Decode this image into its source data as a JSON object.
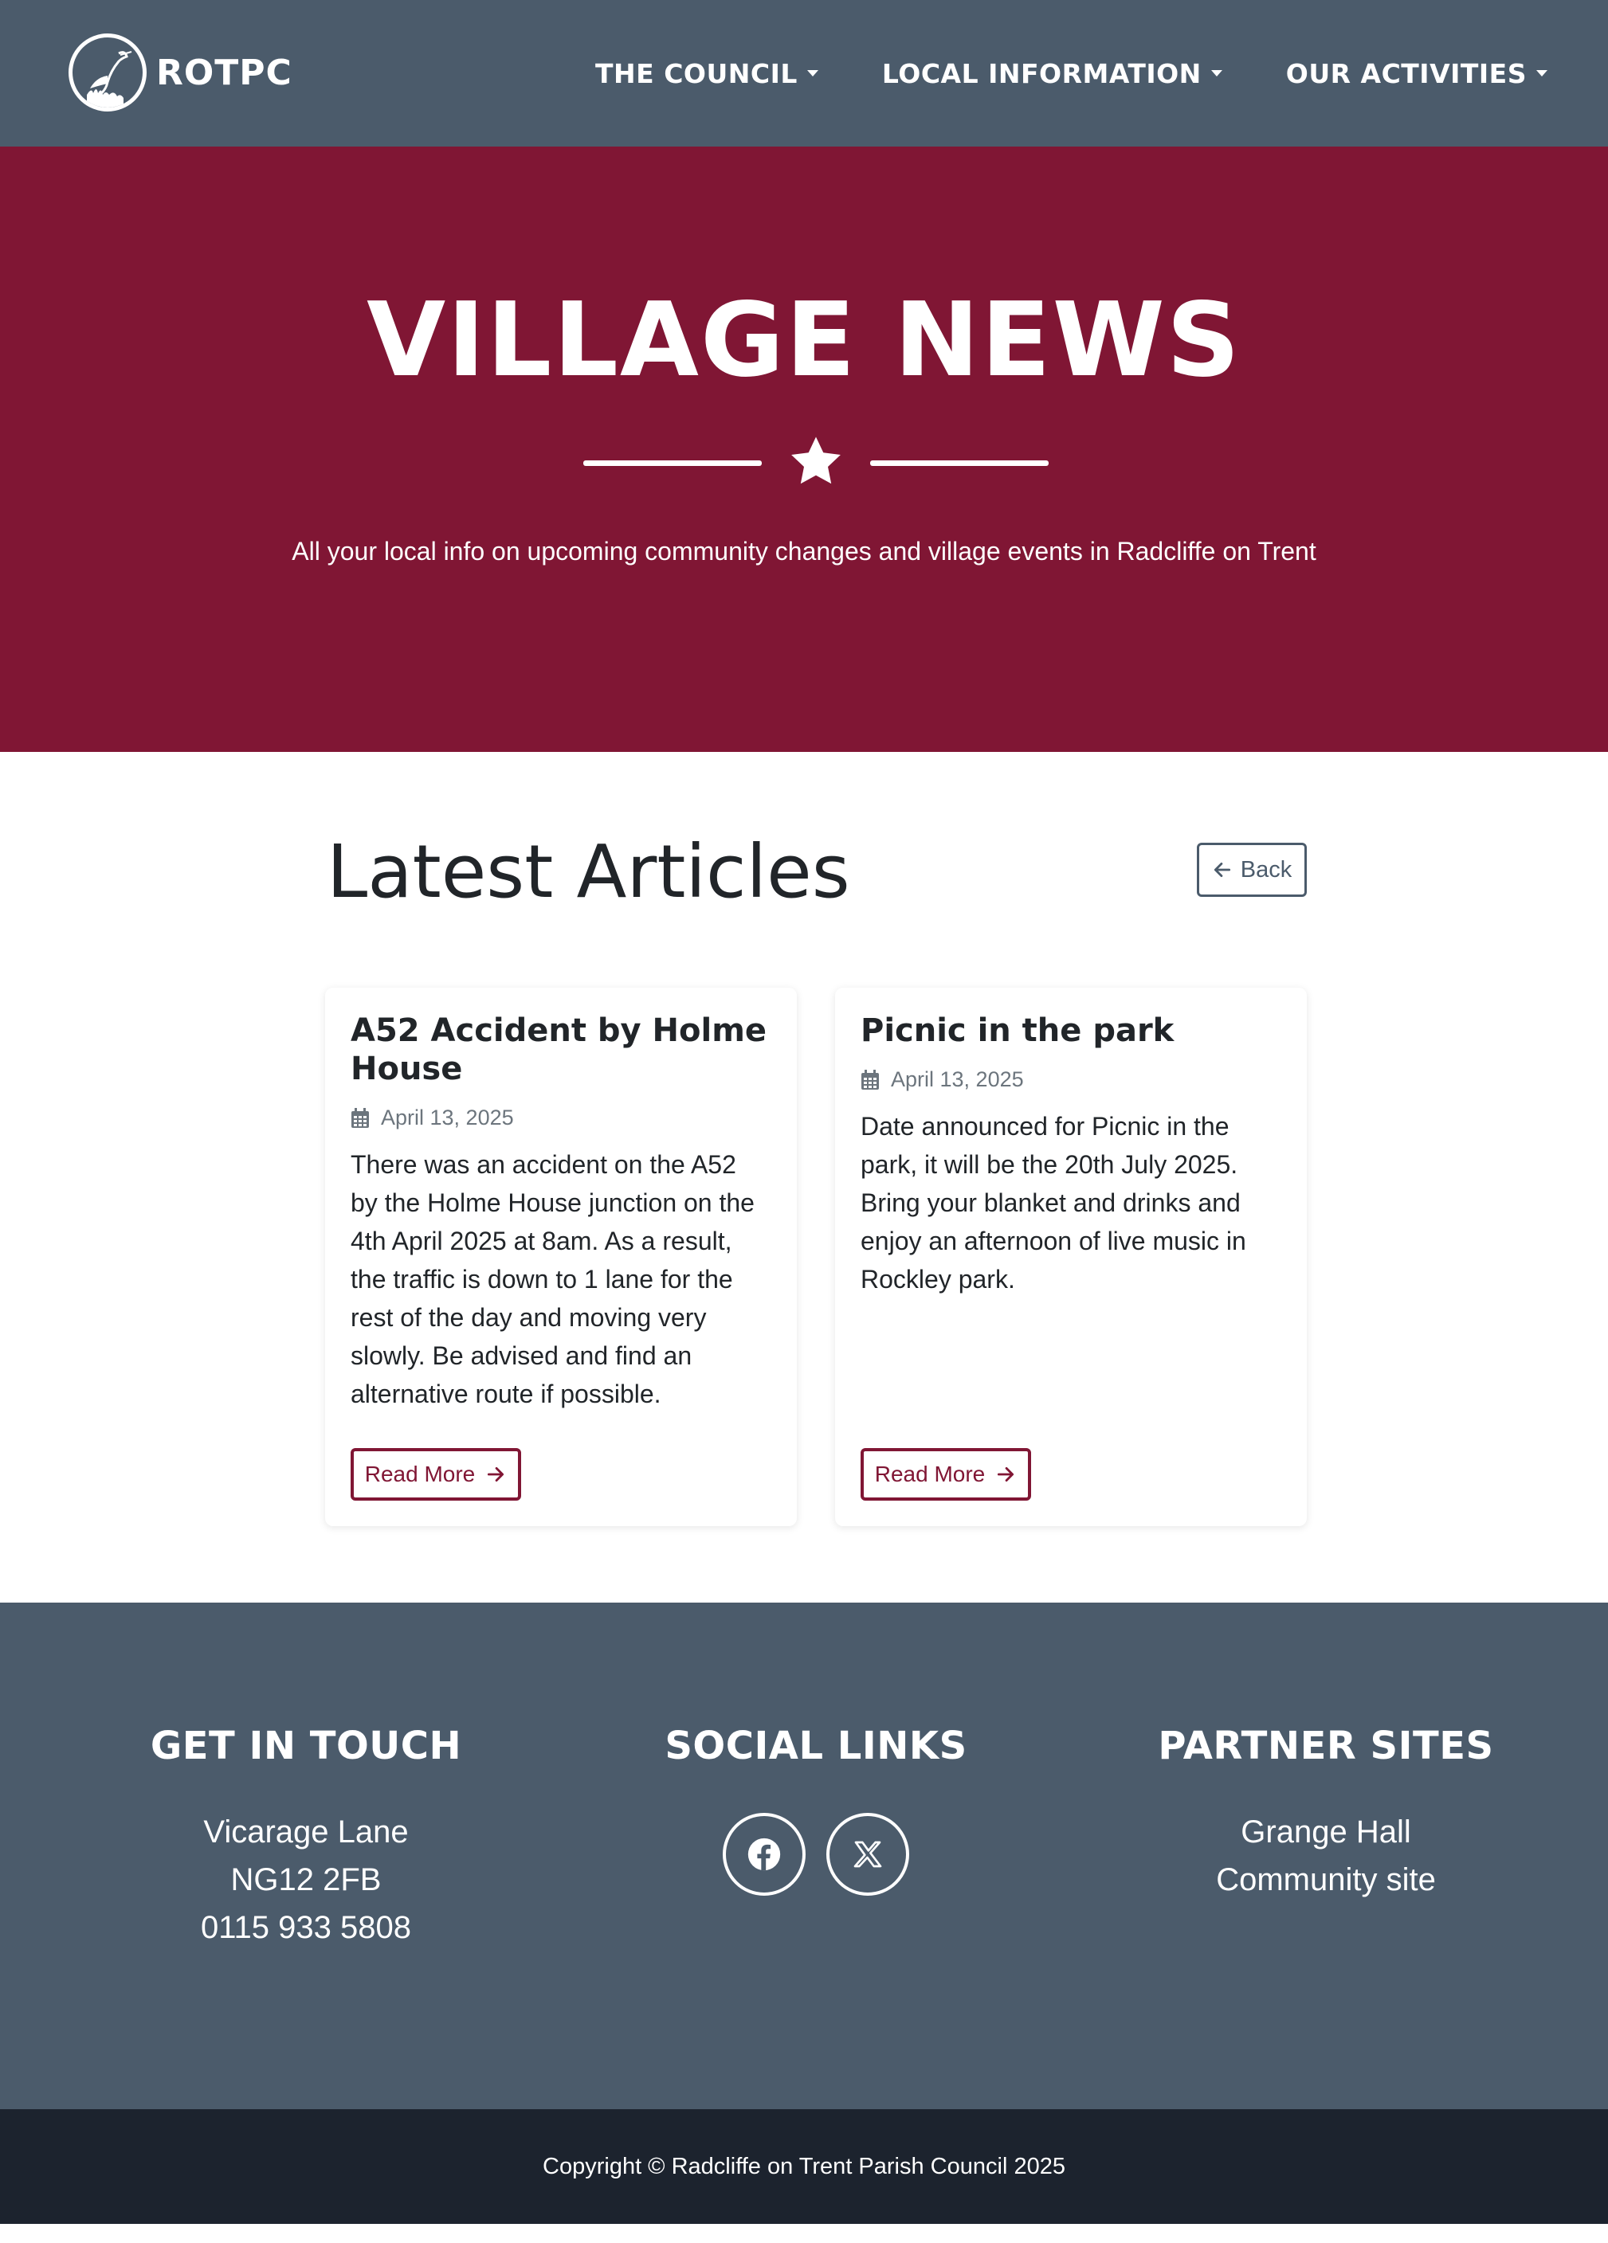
{
  "navbar": {
    "brand": "ROTPC",
    "items": [
      {
        "label": "THE COUNCIL"
      },
      {
        "label": "LOCAL INFORMATION"
      },
      {
        "label": "OUR ACTIVITIES"
      }
    ]
  },
  "hero": {
    "title": "VILLAGE NEWS",
    "subtitle": "All your local info on upcoming community changes and village events in Radcliffe on Trent"
  },
  "articles": {
    "heading": "Latest Articles",
    "back_label": "Back",
    "items": [
      {
        "title": "A52 Accident by Holme House",
        "date": "April 13, 2025",
        "body": "There was an accident on the A52 by the Holme House junction on the 4th April 2025 at 8am. As a result, the traffic is down to 1 lane for the rest of the day and moving very slowly. Be advised and find an alternative route if possible.",
        "read_more": "Read More"
      },
      {
        "title": "Picnic in the park",
        "date": "April 13, 2025",
        "body": "Date announced for Picnic in the park, it will be the 20th July 2025. Bring your blanket and drinks and enjoy an afternoon of live music in Rockley park.",
        "read_more": "Read More"
      }
    ]
  },
  "footer": {
    "contact": {
      "heading": "GET IN TOUCH",
      "lines": [
        "Vicarage Lane",
        "NG12 2FB",
        "0115 933 5808"
      ]
    },
    "social": {
      "heading": "SOCIAL LINKS",
      "icons": [
        "facebook-icon",
        "x-icon"
      ]
    },
    "partners": {
      "heading": "PARTNER SITES",
      "links": [
        "Grange Hall",
        "Community site"
      ]
    },
    "copyright": "Copyright © Radcliffe on Trent Parish Council 2025"
  },
  "colors": {
    "nav_bg": "#4b5b6b",
    "hero_bg": "#801634",
    "footer_bg": "#4b5b6b",
    "copyright_bg": "#1c232e",
    "accent": "#801634"
  }
}
